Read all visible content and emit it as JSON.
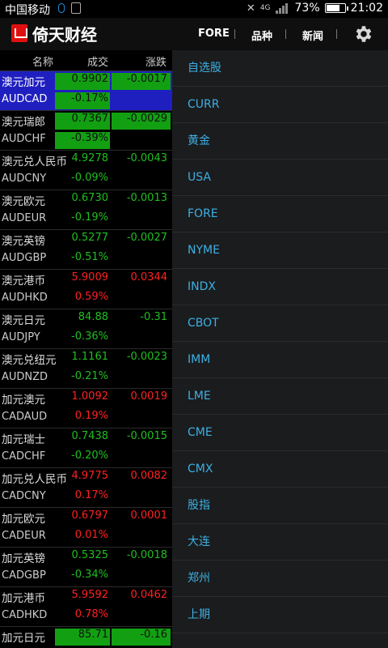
{
  "status": {
    "carrier": "中国移动",
    "battery": "73%",
    "time": "21:02",
    "net": "4G"
  },
  "app": {
    "title": "倚天财经"
  },
  "nav": [
    "FORE",
    "品种",
    "新闻"
  ],
  "table": {
    "headers": [
      "名称",
      "成交",
      "涨跌"
    ],
    "rows": [
      {
        "name": "澳元加元",
        "code": "AUDCAD",
        "price": "0.9902",
        "pct": "-0.17%",
        "chg": "-0.0017",
        "dir": "down",
        "hl": "sel"
      },
      {
        "name": "澳元瑞郎",
        "code": "AUDCHF",
        "price": "0.7367",
        "pct": "-0.39%",
        "chg": "-0.0029",
        "dir": "down",
        "hl": "green"
      },
      {
        "name": "澳元兑人民币",
        "code": "AUDCNY",
        "price": "4.9278",
        "pct": "-0.09%",
        "chg": "-0.0043",
        "dir": "down",
        "hl": ""
      },
      {
        "name": "澳元欧元",
        "code": "AUDEUR",
        "price": "0.6730",
        "pct": "-0.19%",
        "chg": "-0.0013",
        "dir": "down",
        "hl": ""
      },
      {
        "name": "澳元英镑",
        "code": "AUDGBP",
        "price": "0.5277",
        "pct": "-0.51%",
        "chg": "-0.0027",
        "dir": "down",
        "hl": ""
      },
      {
        "name": "澳元港币",
        "code": "AUDHKD",
        "price": "5.9009",
        "pct": "0.59%",
        "chg": "0.0344",
        "dir": "up",
        "hl": ""
      },
      {
        "name": "澳元日元",
        "code": "AUDJPY",
        "price": "84.88",
        "pct": "-0.36%",
        "chg": "-0.31",
        "dir": "down",
        "hl": ""
      },
      {
        "name": "澳元兑纽元",
        "code": "AUDNZD",
        "price": "1.1161",
        "pct": "-0.21%",
        "chg": "-0.0023",
        "dir": "down",
        "hl": ""
      },
      {
        "name": "加元澳元",
        "code": "CADAUD",
        "price": "1.0092",
        "pct": "0.19%",
        "chg": "0.0019",
        "dir": "up",
        "hl": ""
      },
      {
        "name": "加元瑞士",
        "code": "CADCHF",
        "price": "0.7438",
        "pct": "-0.20%",
        "chg": "-0.0015",
        "dir": "down",
        "hl": ""
      },
      {
        "name": "加元兑人民币",
        "code": "CADCNY",
        "price": "4.9775",
        "pct": "0.17%",
        "chg": "0.0082",
        "dir": "up",
        "hl": ""
      },
      {
        "name": "加元欧元",
        "code": "CADEUR",
        "price": "0.6797",
        "pct": "0.01%",
        "chg": "0.0001",
        "dir": "up",
        "hl": ""
      },
      {
        "name": "加元英镑",
        "code": "CADGBP",
        "price": "0.5325",
        "pct": "-0.34%",
        "chg": "-0.0018",
        "dir": "down",
        "hl": ""
      },
      {
        "name": "加元港币",
        "code": "CADHKD",
        "price": "5.9592",
        "pct": "0.78%",
        "chg": "0.0462",
        "dir": "up",
        "hl": ""
      },
      {
        "name": "加元日元",
        "code": "",
        "price": "85.71",
        "pct": "",
        "chg": "-0.16",
        "dir": "down",
        "hl": "green"
      }
    ]
  },
  "markets": [
    "自选股",
    "CURR",
    "黄金",
    "USA",
    "FORE",
    "NYME",
    "INDX",
    "CBOT",
    "IMM",
    "LME",
    "CME",
    "CMX",
    "股指",
    "大连",
    "郑州",
    "上期"
  ],
  "colors": {
    "up": "#ff2020",
    "down": "#1fbf1f",
    "highlight": "#12a012",
    "selected": "#1f1fc0",
    "link": "#3db0e3"
  }
}
